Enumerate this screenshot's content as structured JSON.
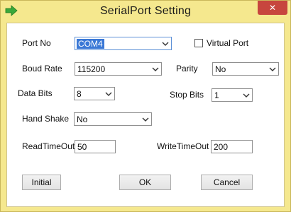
{
  "window": {
    "title": "SerialPort Setting",
    "close_glyph": "✕",
    "app_icon": "green-arrow-icon"
  },
  "port": {
    "label": "Port No",
    "value": "COM4"
  },
  "virtual_port": {
    "label": "Virtual Port",
    "checked": false
  },
  "baud": {
    "label": "Boud Rate",
    "value": "115200"
  },
  "parity": {
    "label": "Parity",
    "value": "No"
  },
  "data_bits": {
    "label": "Data Bits",
    "value": "8"
  },
  "stop_bits": {
    "label": "Stop Bits",
    "value": "1"
  },
  "hand_shake": {
    "label": "Hand Shake",
    "value": "No"
  },
  "read_timeout": {
    "label": "ReadTimeOut",
    "value": "50"
  },
  "write_timeout": {
    "label": "WriteTimeOut",
    "value": "200"
  },
  "buttons": {
    "initial": "Initial",
    "ok": "OK",
    "cancel": "Cancel"
  },
  "colors": {
    "title_bar": "#f5e88e",
    "close_button": "#c7463e",
    "selection": "#3a78d6",
    "icon_green": "#3aa83a"
  }
}
